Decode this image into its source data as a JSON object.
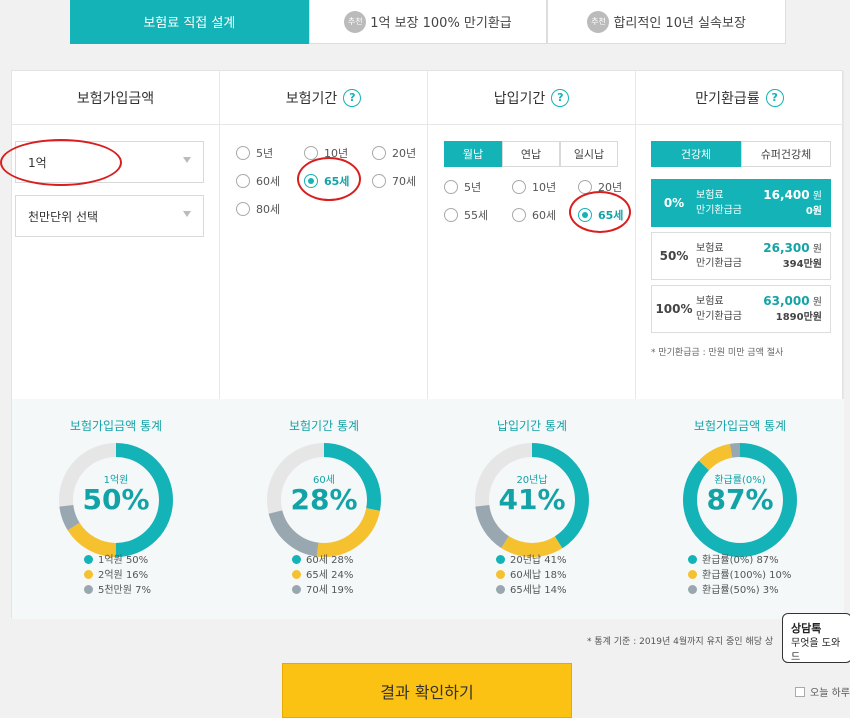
{
  "tabs": [
    {
      "label": "보험료 직접 설계",
      "badge": ""
    },
    {
      "label": "1억 보장 100% 만기환급",
      "badge": "추천"
    },
    {
      "label": "합리적인 10년 실속보장",
      "badge": "추천"
    }
  ],
  "columns": {
    "amount": {
      "title": "보험가입금액",
      "select1": "1억",
      "select2": "천만단위 선택"
    },
    "term": {
      "title": "보험기간",
      "help": "?",
      "options": [
        "5년",
        "10년",
        "20년",
        "60세",
        "65세",
        "70세",
        "80세"
      ],
      "selected": "65세"
    },
    "payment": {
      "title": "납입기간",
      "help": "?",
      "modes": [
        "월납",
        "연납",
        "일시납"
      ],
      "selected_mode": "월납",
      "options": [
        "5년",
        "10년",
        "20년",
        "55세",
        "60세",
        "65세"
      ],
      "selected": "65세"
    },
    "refund": {
      "title": "만기환급률",
      "help": "?",
      "types": [
        "건강체",
        "슈퍼건강체"
      ],
      "selected_type": "건강체",
      "rows": [
        {
          "pct": "0%",
          "l1": "보험료",
          "l2": "만기환급금",
          "v1": "16,400",
          "u1": "원",
          "v2": "0원"
        },
        {
          "pct": "50%",
          "l1": "보험료",
          "l2": "만기환급금",
          "v1": "26,300",
          "u1": "원",
          "v2": "394만원"
        },
        {
          "pct": "100%",
          "l1": "보험료",
          "l2": "만기환급금",
          "v1": "63,000",
          "u1": "원",
          "v2": "1890만원"
        }
      ],
      "note": "* 만기환급금 : 만원 미만 금액 절사"
    }
  },
  "stats": [
    {
      "title": "보험가입금액 통계",
      "sub": "1억원",
      "big": "50%",
      "legend": [
        "1억원 50%",
        "2억원 16%",
        "5천만원 7%"
      ],
      "values": [
        50,
        16,
        7
      ]
    },
    {
      "title": "보험기간 통계",
      "sub": "60세",
      "big": "28%",
      "legend": [
        "60세 28%",
        "65세 24%",
        "70세 19%"
      ],
      "values": [
        28,
        24,
        19
      ]
    },
    {
      "title": "납입기간 통계",
      "sub": "20년납",
      "big": "41%",
      "legend": [
        "20년납 41%",
        "60세납 18%",
        "65세납 14%"
      ],
      "values": [
        41,
        18,
        14
      ]
    },
    {
      "title": "보험가입금액 통계",
      "sub": "환급률(0%)",
      "big": "87%",
      "legend": [
        "환급률(0%) 87%",
        "환급률(100%) 10%",
        "환급률(50%) 3%"
      ],
      "values": [
        87,
        10,
        3
      ]
    }
  ],
  "colors": {
    "teal": "#13b3b7",
    "yellow": "#f5c12e",
    "gray": "#98a7b0",
    "track": "#e6e6e6",
    "cta": "#fcc213"
  },
  "footnote": "* 통계 기준 : 2019년 4월까지 유지 중인 해당 상",
  "cta": "결과 확인하기",
  "chat": {
    "title": "상담톡",
    "text": "무엇을 도와드"
  },
  "today": "오늘 하루"
}
